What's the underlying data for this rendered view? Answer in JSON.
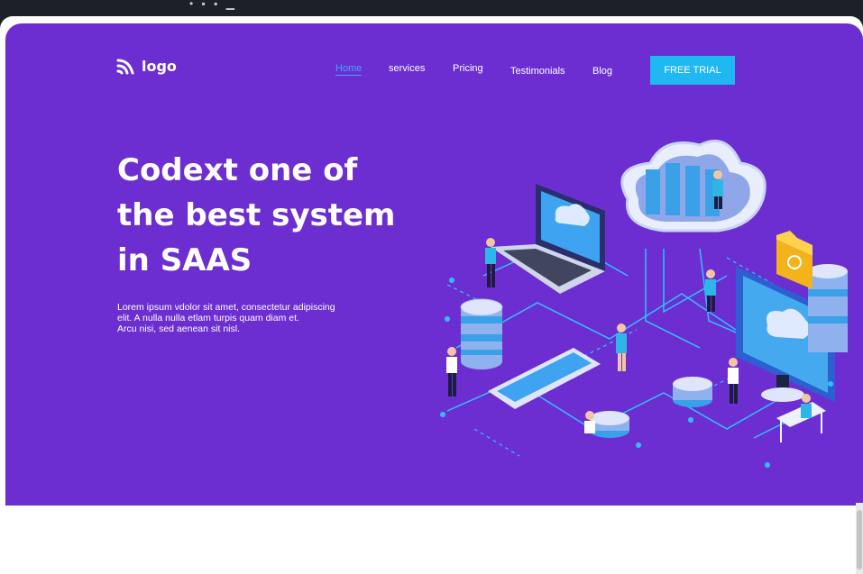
{
  "brand": {
    "logo_text": "logo",
    "logo_icon": "signal-waves-icon"
  },
  "nav": {
    "items": [
      {
        "label": "Home",
        "active": true
      },
      {
        "label": "services"
      },
      {
        "label": "Pricing"
      },
      {
        "label": "Testimonials"
      },
      {
        "label": "Blog"
      }
    ],
    "cta_label": "FREE TRIAL"
  },
  "hero": {
    "headline_lines": [
      "Codext one of",
      "the best system",
      "in SAAS"
    ],
    "subtext_lines": [
      "Lorem ipsum vdolor sit amet, consectetur adipiscing",
      "elit. A nulla nulla etlam turpis quam diam et.",
      "Arcu nisi, sed aenean sit nisl."
    ],
    "illustration": "isometric-cloud-saas-illustration"
  },
  "colors": {
    "hero_background": "#6c2ed1",
    "cta_background": "#1fb8f2",
    "active_link": "#3fa7ff",
    "chrome": "#1d2027"
  }
}
